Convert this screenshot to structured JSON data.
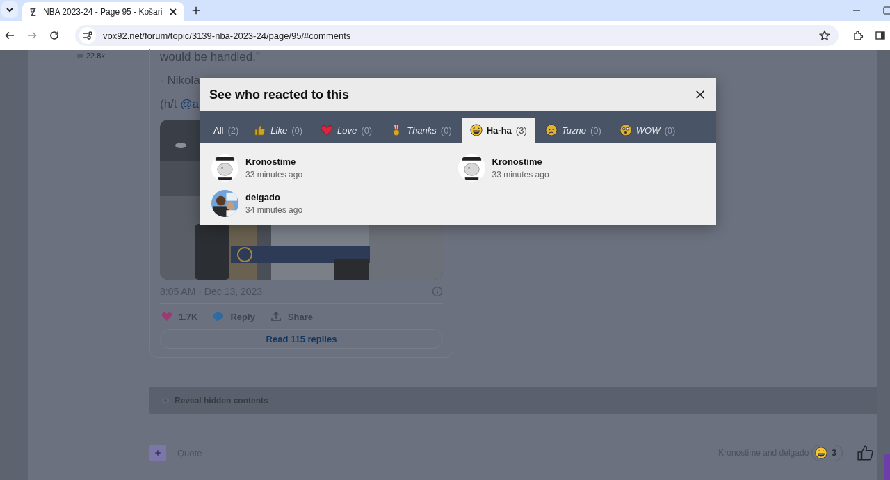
{
  "browser": {
    "tabs": [
      {
        "title": "NBA 2023-24 - Page 95 - Košari",
        "selected": true
      }
    ],
    "url": "vox92.net/forum/topic/3139-nba-2023-24/page/95/#comments"
  },
  "page": {
    "stat": "22.8k",
    "quote_lines": [
      {
        "text": "would be handled.\""
      },
      {
        "text": "- Nikola"
      },
      {
        "text": "(h/t ",
        "link": "@a"
      }
    ],
    "tweet": {
      "timestamp": "8:05 AM · Dec 13, 2023",
      "likes": "1.7K",
      "reply": "Reply",
      "share": "Share",
      "read_replies": "Read 115 replies"
    },
    "reveal": "Reveal hidden contents",
    "footer": {
      "quote": "Quote",
      "reacted_by": "Kronostime and delgado",
      "reaction_count": "3"
    }
  },
  "modal": {
    "title": "See who reacted to this",
    "tabs": [
      {
        "kind": "all",
        "label": "All",
        "count": "(2)",
        "selected": false
      },
      {
        "kind": "like",
        "label": "Like",
        "count": "(0)",
        "selected": false
      },
      {
        "kind": "love",
        "label": "Love",
        "count": "(0)",
        "selected": false
      },
      {
        "kind": "thanks",
        "label": "Thanks",
        "count": "(0)",
        "selected": false
      },
      {
        "kind": "haha",
        "label": "Ha-ha",
        "count": "(3)",
        "selected": true
      },
      {
        "kind": "sad",
        "label": "Tuzno",
        "count": "(0)",
        "selected": false
      },
      {
        "kind": "wow",
        "label": "WOW",
        "count": "(0)",
        "selected": false
      }
    ],
    "users": [
      {
        "name": "Kronostime",
        "time": "33 minutes ago"
      },
      {
        "name": "Kronostime",
        "time": "33 minutes ago"
      },
      {
        "name": "delgado",
        "time": "34 minutes ago"
      }
    ]
  }
}
